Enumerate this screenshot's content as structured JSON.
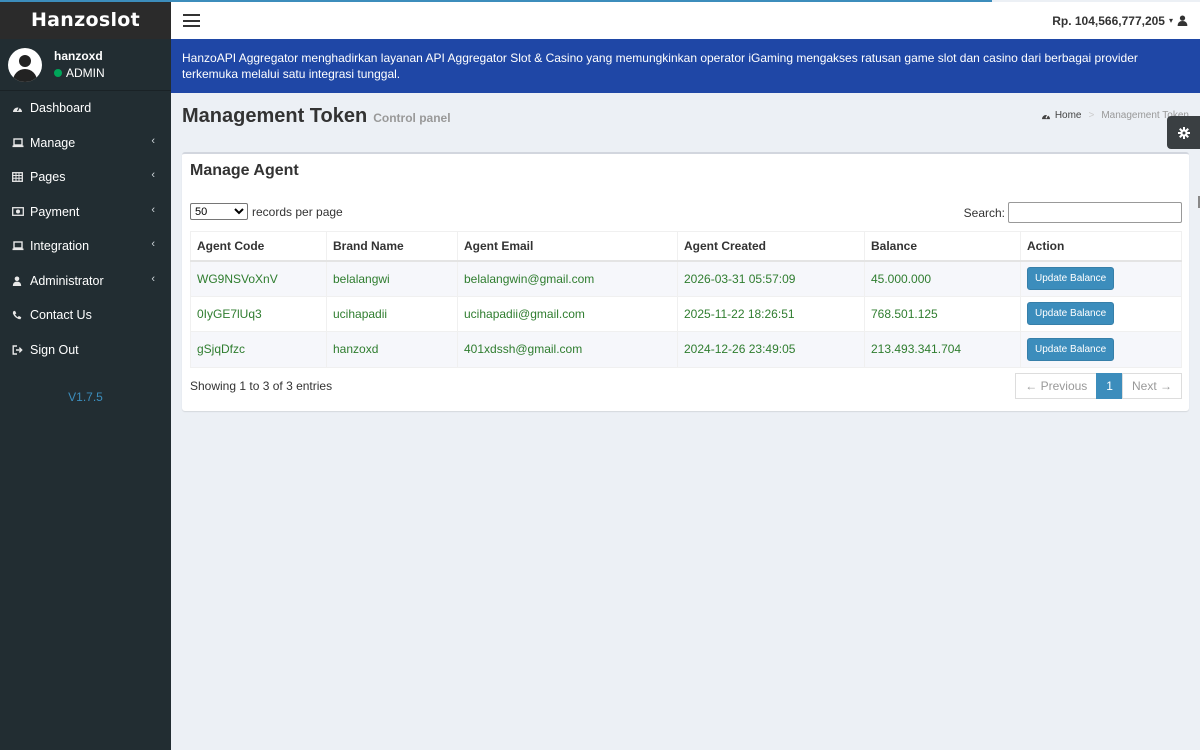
{
  "app": {
    "logo": "Hanzoslot"
  },
  "user": {
    "name": "hanzoxd",
    "role": "ADMIN"
  },
  "sidebar": {
    "items": [
      {
        "label": "Dashboard",
        "icon": "dashboard-icon",
        "chevron": false
      },
      {
        "label": "Manage",
        "icon": "laptop-icon",
        "chevron": true
      },
      {
        "label": "Pages",
        "icon": "table-icon",
        "chevron": true
      },
      {
        "label": "Payment",
        "icon": "money-icon",
        "chevron": true
      },
      {
        "label": "Integration",
        "icon": "laptop-icon",
        "chevron": true
      },
      {
        "label": "Administrator",
        "icon": "user-icon",
        "chevron": true
      },
      {
        "label": "Contact Us",
        "icon": "phone-icon",
        "chevron": false
      },
      {
        "label": "Sign Out",
        "icon": "sign-out-icon",
        "chevron": false
      }
    ],
    "version": "V1.7.5"
  },
  "header": {
    "balance": "Rp. 104,566,777,205"
  },
  "banner": {
    "text": "HanzoAPI Aggregator menghadirkan layanan API Aggregator Slot & Casino yang memungkinkan operator iGaming mengakses ratusan game slot dan casino dari berbagai provider terkemuka melalui satu integrasi tunggal."
  },
  "page": {
    "title": "Management Token",
    "subtitle": "Control panel",
    "breadcrumb": {
      "home": "Home",
      "current": "Management Token"
    }
  },
  "box": {
    "title": "Manage Agent",
    "length": {
      "selected": "50",
      "suffix": "records per page"
    },
    "search": {
      "label": "Search:",
      "value": "",
      "placeholder": ""
    },
    "table": {
      "headers": [
        "Agent Code",
        "Brand Name",
        "Agent Email",
        "Agent Created",
        "Balance",
        "Action"
      ],
      "rows": [
        {
          "code": "WG9NSVoXnV",
          "brand": "belalangwi",
          "email": "belalangwin@gmail.com",
          "created": "2026-03-31 05:57:09",
          "balance": "45.000.000",
          "action": "Update Balance"
        },
        {
          "code": "0IyGE7lUq3",
          "brand": "ucihapadii",
          "email": "ucihapadii@gmail.com",
          "created": "2025-11-22 18:26:51",
          "balance": "768.501.125",
          "action": "Update Balance"
        },
        {
          "code": "gSjqDfzc",
          "brand": "hanzoxd",
          "email": "401xdssh@gmail.com",
          "created": "2024-12-26 23:49:05",
          "balance": "213.493.341.704",
          "action": "Update Balance"
        }
      ]
    },
    "info": "Showing 1 to 3 of 3 entries",
    "pagination": {
      "prev": "← Previous",
      "current": "1",
      "next": "Next →"
    }
  },
  "colors": {
    "sidebar": "#222d32",
    "banner": "#1f47a6",
    "accent": "#3c8dbc",
    "cell_text": "#2f7d2f"
  }
}
